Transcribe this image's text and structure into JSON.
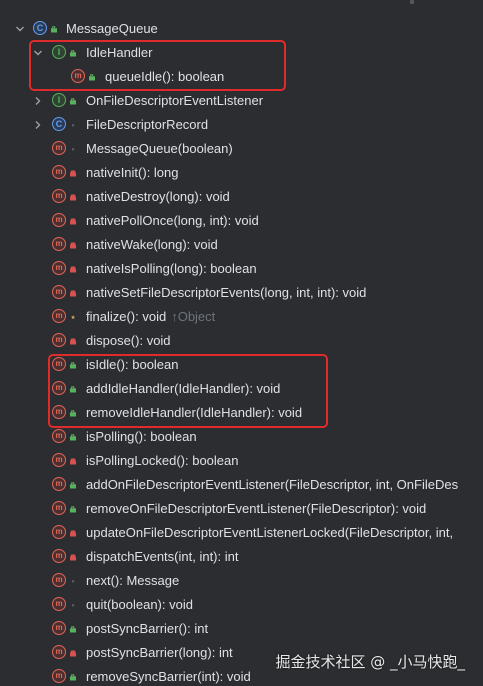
{
  "structure": {
    "root": {
      "label": "MessageQueue",
      "kind": "class",
      "expanded": true
    },
    "items": [
      {
        "label": "IdleHandler",
        "kind": "interface",
        "modifier": "public",
        "expandable": true,
        "expanded": true,
        "depth": 1
      },
      {
        "label": "queueIdle(): boolean",
        "kind": "method",
        "modifier": "public",
        "depth": 2
      },
      {
        "label": "OnFileDescriptorEventListener",
        "kind": "interface",
        "modifier": "public",
        "expandable": true,
        "expanded": false,
        "depth": 1
      },
      {
        "label": "FileDescriptorRecord",
        "kind": "class",
        "modifier": "package",
        "expandable": true,
        "expanded": false,
        "depth": 1
      },
      {
        "label": "MessageQueue(boolean)",
        "kind": "method",
        "modifier": "package",
        "depth": 1
      },
      {
        "label": "nativeInit(): long",
        "kind": "method",
        "modifier": "private",
        "depth": 1
      },
      {
        "label": "nativeDestroy(long): void",
        "kind": "method",
        "modifier": "private",
        "depth": 1
      },
      {
        "label": "nativePollOnce(long, int): void",
        "kind": "method",
        "modifier": "private",
        "depth": 1
      },
      {
        "label": "nativeWake(long): void",
        "kind": "method",
        "modifier": "private",
        "depth": 1
      },
      {
        "label": "nativeIsPolling(long): boolean",
        "kind": "method",
        "modifier": "private",
        "depth": 1
      },
      {
        "label": "nativeSetFileDescriptorEvents(long, int, int): void",
        "kind": "method",
        "modifier": "private",
        "depth": 1
      },
      {
        "label": "finalize(): void",
        "suffix": "↑Object",
        "kind": "method",
        "modifier": "protected",
        "depth": 1
      },
      {
        "label": "dispose(): void",
        "kind": "method",
        "modifier": "private",
        "depth": 1
      },
      {
        "label": "isIdle(): boolean",
        "kind": "method",
        "modifier": "public",
        "depth": 1
      },
      {
        "label": "addIdleHandler(IdleHandler): void",
        "kind": "method",
        "modifier": "public",
        "depth": 1
      },
      {
        "label": "removeIdleHandler(IdleHandler): void",
        "kind": "method",
        "modifier": "public",
        "depth": 1
      },
      {
        "label": "isPolling(): boolean",
        "kind": "method",
        "modifier": "public",
        "depth": 1
      },
      {
        "label": "isPollingLocked(): boolean",
        "kind": "method",
        "modifier": "private",
        "depth": 1
      },
      {
        "label": "addOnFileDescriptorEventListener(FileDescriptor, int, OnFileDes",
        "kind": "method",
        "modifier": "public",
        "depth": 1
      },
      {
        "label": "removeOnFileDescriptorEventListener(FileDescriptor): void",
        "kind": "method",
        "modifier": "public",
        "depth": 1
      },
      {
        "label": "updateOnFileDescriptorEventListenerLocked(FileDescriptor, int,",
        "kind": "method",
        "modifier": "private",
        "depth": 1
      },
      {
        "label": "dispatchEvents(int, int): int",
        "kind": "method",
        "modifier": "private",
        "depth": 1
      },
      {
        "label": "next(): Message",
        "kind": "method",
        "modifier": "package",
        "depth": 1
      },
      {
        "label": "quit(boolean): void",
        "kind": "method",
        "modifier": "package",
        "depth": 1
      },
      {
        "label": "postSyncBarrier(): int",
        "kind": "method",
        "modifier": "public",
        "depth": 1
      },
      {
        "label": "postSyncBarrier(long): int",
        "kind": "method",
        "modifier": "private",
        "depth": 1
      },
      {
        "label": "removeSyncBarrier(int): void",
        "kind": "method",
        "modifier": "public",
        "depth": 1
      }
    ]
  },
  "icon_letters": {
    "class": "C",
    "interface": "I",
    "method": "m"
  },
  "watermark": "掘金技术社区 @ _小马快跑_",
  "colors": {
    "background": "#2b2d30",
    "text": "#dfe1e5",
    "class_icon": "#5fa0f0",
    "interface_icon": "#5ab05e",
    "method_icon": "#e0675c",
    "highlight_box": "#e02b2b"
  }
}
